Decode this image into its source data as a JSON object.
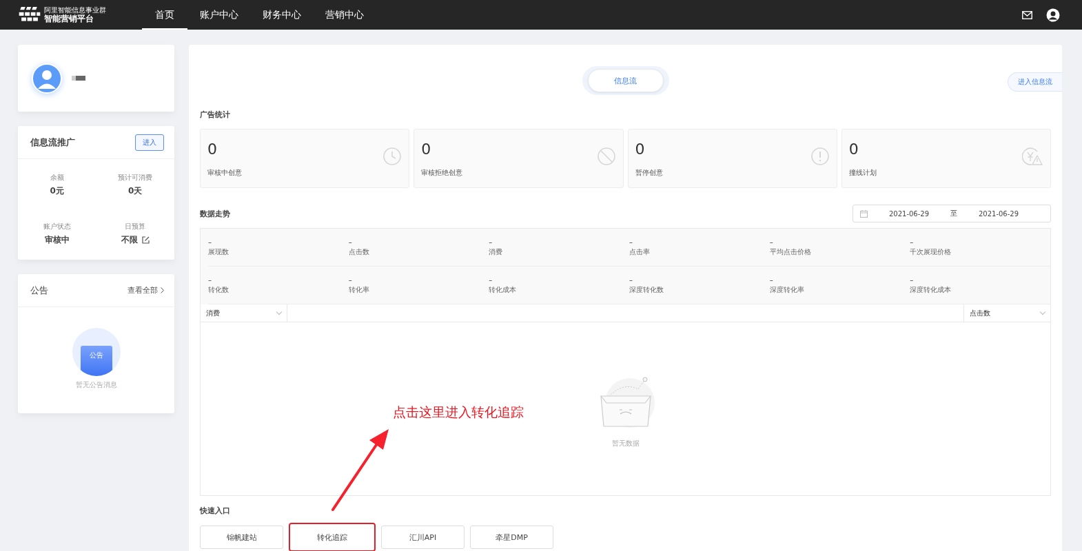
{
  "nav": {
    "logo_subtitle": "阿里智能信息事业群",
    "logo_title": "智能营销平台",
    "tabs": [
      {
        "label": "首页",
        "selected": true
      },
      {
        "label": "账户中心",
        "selected": false
      },
      {
        "label": "财务中心",
        "selected": false
      },
      {
        "label": "营销中心",
        "selected": false
      }
    ]
  },
  "promo_card": {
    "title": "信息流推广",
    "enter_button": "进入",
    "stats": [
      {
        "label": "余额",
        "value": "0元",
        "editable": false
      },
      {
        "label": "预计可消费",
        "value": "0天",
        "editable": false
      },
      {
        "label": "账户状态",
        "value": "审核中",
        "editable": false
      },
      {
        "label": "日预算",
        "value": "不限",
        "editable": true
      }
    ]
  },
  "announcements": {
    "title": "公告",
    "view_all": "查看全部",
    "badge_text": "公告",
    "empty_text": "暂无公告消息"
  },
  "main": {
    "channel_tabs": [
      {
        "label": "信息流",
        "selected": true
      }
    ],
    "enter_link": "进入信息流",
    "ad_stats": {
      "title": "广告统计",
      "cards": [
        {
          "value": "0",
          "label": "审核中创意",
          "kind": "clock"
        },
        {
          "value": "0",
          "label": "审核拒绝创意",
          "kind": "forbidden"
        },
        {
          "value": "0",
          "label": "暂停创意",
          "kind": "alert"
        },
        {
          "value": "0",
          "label": "撞线计划",
          "kind": "yen"
        }
      ]
    },
    "trend": {
      "title": "数据走势",
      "date_from": "2021-06-29",
      "date_separator": "至",
      "date_to": "2021-06-29",
      "metrics": [
        {
          "value": "–",
          "label": "展现数"
        },
        {
          "value": "–",
          "label": "点击数"
        },
        {
          "value": "–",
          "label": "消费"
        },
        {
          "value": "–",
          "label": "点击率"
        },
        {
          "value": "–",
          "label": "平均点击价格"
        },
        {
          "value": "–",
          "label": "千次展现价格"
        },
        {
          "value": "–",
          "label": "转化数"
        },
        {
          "value": "–",
          "label": "转化率"
        },
        {
          "value": "–",
          "label": "转化成本"
        },
        {
          "value": "–",
          "label": "深度转化数"
        },
        {
          "value": "–",
          "label": "深度转化率"
        },
        {
          "value": "–",
          "label": "深度转化成本"
        }
      ],
      "left_select": "消费",
      "right_select": "点击数",
      "empty_text": "暂无数据"
    },
    "quick_entry": {
      "title": "快速入口",
      "items": [
        {
          "label": "锦帆建站",
          "highlighted": false
        },
        {
          "label": "转化追踪",
          "highlighted": true
        },
        {
          "label": "汇川API",
          "highlighted": false
        },
        {
          "label": "牵星DMP",
          "highlighted": false
        }
      ]
    },
    "annotation": {
      "text": "点击这里进入转化追踪"
    }
  }
}
